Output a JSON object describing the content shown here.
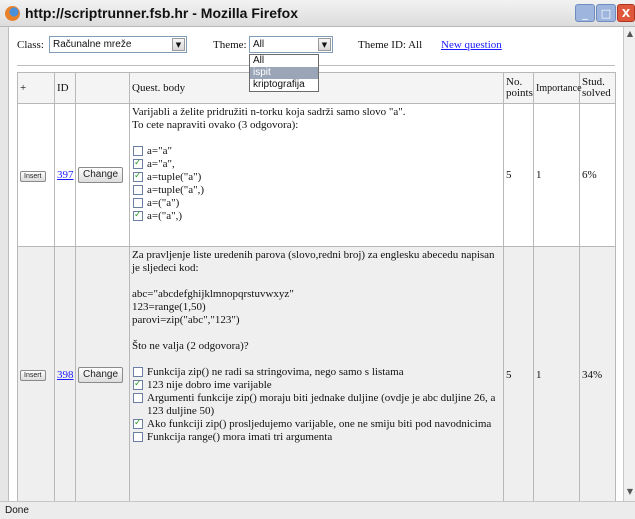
{
  "window": {
    "title": "http://scriptrunner.fsb.hr - Mozilla Firefox",
    "minimize_glyph": "_",
    "maximize_glyph": "□",
    "close_glyph": "X"
  },
  "controls": {
    "class_label": "Class:",
    "class_value": "Računalne mreže",
    "theme_label": "Theme:",
    "theme_value": "All",
    "theme_options": [
      "All",
      "ispit",
      "kriptografija"
    ],
    "theme_highlighted": "ispit",
    "theme_id_label": "Theme ID: All",
    "new_question_link": "New question"
  },
  "table": {
    "headers": {
      "plus": "+",
      "id": "ID",
      "body": "Quest. body",
      "points": "No. points",
      "importance": "Importance",
      "solved": "Stud. solved"
    },
    "rows": [
      {
        "insert_label": "Insert",
        "id": "397",
        "change_label": "Change",
        "intro": [
          "Varijabli a želite pridružiti n-torku koja sadrži samo slovo \"a\".",
          "To cete napraviti ovako (3 odgovora):"
        ],
        "options": [
          {
            "text": "a=\"a\"",
            "checked": false
          },
          {
            "text": "a=\"a\",",
            "checked": true
          },
          {
            "text": "a=tuple(\"a\")",
            "checked": true
          },
          {
            "text": "a=tuple(\"a\",)",
            "checked": false
          },
          {
            "text": "a=(\"a\")",
            "checked": false
          },
          {
            "text": "a=(\"a\",)",
            "checked": true
          }
        ],
        "points": "5",
        "importance": "1",
        "solved": "6%"
      },
      {
        "insert_label": "Insert",
        "id": "398",
        "change_label": "Change",
        "intro": [
          "Za pravljenje liste uredenih parova (slovo,redni broj) za englesku abecedu napisan je sljedeci kod:"
        ],
        "code": [
          "abc=\"abcdefghijklmnopqrstuvwxyz\"",
          "123=range(1,50)",
          "parovi=zip(\"abc\",\"123\")"
        ],
        "question": "Što ne valja (2 odgovora)?",
        "options": [
          {
            "text": "Funkcija zip() ne radi sa stringovima, nego samo s listama",
            "checked": false
          },
          {
            "text": "123 nije dobro ime varijable",
            "checked": true
          },
          {
            "text": "Argumenti funkcije zip() moraju biti jednake duljine (ovdje je abc duljine 26, a 123 duljine 50)",
            "checked": false
          },
          {
            "text": "Ako funkciji zip() prosljedujemo varijable, one ne smiju biti pod navodnicima",
            "checked": true
          },
          {
            "text": "Funkcija range() mora imati tri argumenta",
            "checked": false
          }
        ],
        "points": "5",
        "importance": "1",
        "solved": "34%"
      }
    ]
  },
  "status": {
    "text": "Done"
  },
  "colors": {
    "link": "#1a1aff",
    "checkmark": "#2a9a2a",
    "dropdown_highlight": "#9aa6b8",
    "close_button": "#e0583c"
  }
}
